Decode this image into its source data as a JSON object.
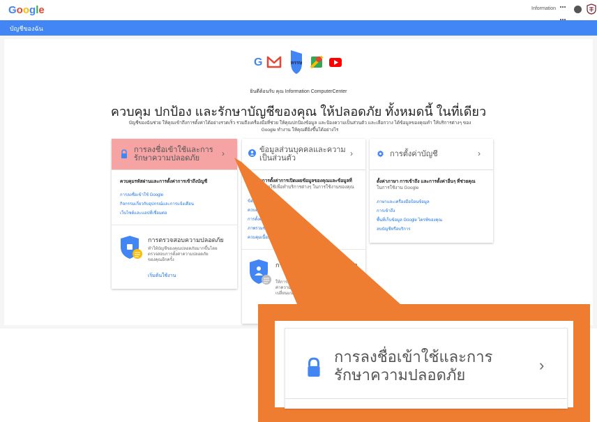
{
  "header": {
    "logo_letters": [
      "G",
      "o",
      "o",
      "g",
      "l",
      "e"
    ],
    "user_name": "Information",
    "icons": [
      "apps-icon",
      "notifications-icon",
      "avatar-icon"
    ]
  },
  "bar": {
    "title": "บัญชีของฉัน"
  },
  "hero": {
    "app_icons": [
      "google-g-icon",
      "gmail-icon",
      "account-shield-icon",
      "maps-icon",
      "youtube-icon"
    ],
    "avatar_label": "หรรษ",
    "welcome": "ยินดีต้อนรับ คุณ Information ComputerCenter",
    "headline": "ควบคุม ปกป้อง และรักษาบัญชีของคุณ ให้ปลอดภัย ทั้งหมดนี้ ในที่เดียว",
    "description_line1": "บัญชีของฉันช่วย ให้คุณเข้าถึงการตั้งค่าได้อย่างรวดเร็ว รวมถึงเครื่องมือที่ช่วย ให้คุณปกป้องข้อมูล และป้องความเป็นส่วนตัว และเลือกวาง ได้ข้อมูลของคุณทำ ให้บริการต่างๆ ของ",
    "description_line2": "Google ทำงาน ให้คุณดียิ่งขึ้นได้อย่างไร"
  },
  "cards": {
    "signin": {
      "title_line1": "การลงชื่อเข้าใช้และการ",
      "title_line2": "รักษาความปลอดภัย",
      "subtitle": "ควบคุมรหัสผ่านและการตั้งค่าการเข้าถึงบัญชี",
      "links": [
        "การลงชื่อเข้าใช้ Google",
        "กิจกรรมเกี่ยวกับอุปกรณ์และการแจ้งเตือน",
        "เว็บไซต์และแอปที่เชื่อมต่อ"
      ],
      "security_title": "การตรวจสอบความปลอดภัย",
      "security_text": [
        "ทำให้บัญชีของคุณปลอดภัยมากขึ้นโดย",
        "ตรวจสอบการตั้งค่าความปลอดภัย",
        "ของคุณอีกครั้ง"
      ],
      "start_link": "เริ่มต้นใช้งาน"
    },
    "privacy": {
      "title_line1": "ข้อมูลส่วนบุคคลและความ",
      "title_line2": "เป็นส่วนตัว",
      "subtitle": [
        "ควบคุมการตั้งค่าการเปิดเผยข้อมูลของคุณและข้อมูลที่",
        "เราสามารถใช้เพื่อทำบริการต่างๆ ในการใช้งานของคุณ"
      ],
      "links": [
        "ข้อมูลส่วนตัว",
        "ควบคุมกิจกรรม",
        "การตั้งค่าโฆษณา",
        "ภาพรวมของบัญชี",
        "ควบคุมเนื้อหา"
      ],
      "check_title": "การตรวจสอบความเป็นส่วนตัว",
      "check_text": [
        "ให้การตรวจสอบความเป็นส่วนตัว",
        "ค่าความเป็นส่วนตัวที่สำคัญและ",
        "เปลี่ยนแปลงความเป็นส่วนตัว"
      ]
    },
    "prefs": {
      "title": "การตั้งค่าบัญชี",
      "subtitle": [
        "ตั้งค่าภาษา การเข้าถึง และการตั้งค่าอื่นๆ ที่ช่วยคุณ",
        "ในการใช้งาน Google"
      ],
      "links": [
        "ภาษาและเครื่องมือป้อนข้อมูล",
        "การเข้าถึง",
        "พื้นที่เก็บข้อมูล Google ไดรฟ์ของคุณ",
        "ลบบัญชีหรือบริการ"
      ]
    }
  },
  "callout": {
    "title_line1": "การลงชื่อเข้าใช้และการ",
    "title_line2": "รักษาความปลอดภัย",
    "accent_color": "#ef7d31"
  },
  "colors": {
    "brand_blue": "#4285f4",
    "highlight": "#f5a3a3",
    "link": "#1a73e8"
  }
}
